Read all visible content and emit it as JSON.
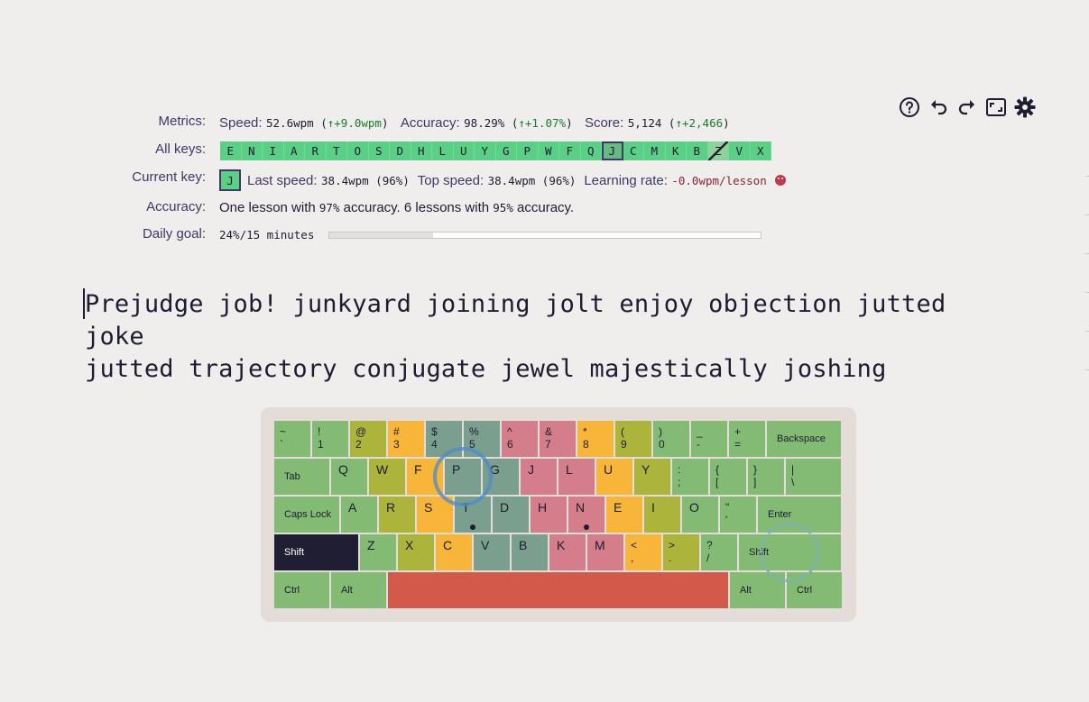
{
  "toolbar": {
    "help_icon": "help-circle-icon",
    "undo_icon": "undo-icon",
    "redo_icon": "redo-icon",
    "fullscreen_icon": "fullscreen-icon",
    "settings_icon": "gear-icon"
  },
  "metrics": {
    "label": "Metrics:",
    "speed_label": "Speed:",
    "speed_value": "52.6wpm",
    "speed_delta": "↑+9.0wpm",
    "accuracy_label": "Accuracy:",
    "accuracy_value": "98.29%",
    "accuracy_delta": "↑+1.07%",
    "score_label": "Score:",
    "score_value": "5,124",
    "score_delta": "↑+2,466"
  },
  "all_keys": {
    "label": "All keys:",
    "keys": [
      "E",
      "N",
      "I",
      "A",
      "R",
      "T",
      "O",
      "S",
      "D",
      "H",
      "L",
      "U",
      "Y",
      "G",
      "P",
      "W",
      "F",
      "Q",
      "J",
      "C",
      "M",
      "K",
      "B",
      "Z",
      "V",
      "X"
    ],
    "current": "J",
    "excluded": "Z"
  },
  "current_key": {
    "label": "Current key:",
    "key": "J",
    "last_speed_label": "Last speed:",
    "last_speed_value": "38.4wpm (96%)",
    "top_speed_label": "Top speed:",
    "top_speed_value": "38.4wpm (96%)",
    "learning_rate_label": "Learning rate:",
    "learning_rate_value": "-0.0wpm/lesson",
    "mood_icon": "sad-face-icon"
  },
  "accuracy_row": {
    "label": "Accuracy:",
    "text_a": "One lesson with ",
    "pct_a": "97%",
    "text_b": " accuracy. 6 lessons with ",
    "pct_b": "95%",
    "text_c": " accuracy."
  },
  "daily_goal": {
    "label": "Daily goal:",
    "value": "24%/15 minutes",
    "progress": 0.24
  },
  "lesson": {
    "line1": "Prejudge job! junkyard joining jolt enjoy objection jutted joke",
    "line2": "jutted trajectory conjugate jewel majestically joshing"
  },
  "keyboard": {
    "rows": [
      [
        {
          "t": "~",
          "b": "`",
          "c": "g",
          "w": 40
        },
        {
          "t": "!",
          "b": "1",
          "c": "g",
          "w": 40
        },
        {
          "t": "@",
          "b": "2",
          "c": "y",
          "w": 40
        },
        {
          "t": "#",
          "b": "3",
          "c": "o",
          "w": 40
        },
        {
          "t": "$",
          "b": "4",
          "c": "t",
          "w": 40
        },
        {
          "t": "%",
          "b": "5",
          "c": "t",
          "w": 40
        },
        {
          "t": "^",
          "b": "6",
          "c": "p",
          "w": 40
        },
        {
          "t": "&",
          "b": "7",
          "c": "p",
          "w": 40
        },
        {
          "t": "*",
          "b": "8",
          "c": "o",
          "w": 40
        },
        {
          "t": "(",
          "b": "9",
          "c": "y",
          "w": 40
        },
        {
          "t": ")",
          "b": "0",
          "c": "g",
          "w": 40
        },
        {
          "t": "_",
          "b": "-",
          "c": "g",
          "w": 40
        },
        {
          "t": "+",
          "b": "=",
          "c": "g",
          "w": 40
        },
        {
          "s": "Backspace",
          "c": "g",
          "w": 82
        }
      ],
      [
        {
          "s": "Tab",
          "c": "g",
          "w": 61
        },
        {
          "k": "Q",
          "c": "g",
          "w": 40
        },
        {
          "k": "W",
          "c": "y",
          "w": 40
        },
        {
          "k": "F",
          "c": "o",
          "w": 40
        },
        {
          "k": "P",
          "c": "t",
          "w": 40
        },
        {
          "k": "G",
          "c": "t",
          "w": 40
        },
        {
          "k": "J",
          "c": "p",
          "w": 40
        },
        {
          "k": "L",
          "c": "p",
          "w": 40
        },
        {
          "k": "U",
          "c": "o",
          "w": 40
        },
        {
          "k": "Y",
          "c": "y",
          "w": 40
        },
        {
          "t": ":",
          "b": ";",
          "c": "g",
          "w": 40
        },
        {
          "t": "{",
          "b": "[",
          "c": "g",
          "w": 40
        },
        {
          "t": "}",
          "b": "]",
          "c": "g",
          "w": 40
        },
        {
          "t": "|",
          "b": "\\",
          "c": "g",
          "w": 61
        }
      ],
      [
        {
          "s": "Caps Lock",
          "c": "g",
          "w": 72
        },
        {
          "k": "A",
          "c": "g",
          "w": 40
        },
        {
          "k": "R",
          "c": "y",
          "w": 40
        },
        {
          "k": "S",
          "c": "o",
          "w": 40
        },
        {
          "k": "T",
          "c": "t",
          "w": 40,
          "bump": true
        },
        {
          "k": "D",
          "c": "t",
          "w": 40
        },
        {
          "k": "H",
          "c": "p",
          "w": 40
        },
        {
          "k": "N",
          "c": "p",
          "w": 40,
          "bump": true
        },
        {
          "k": "E",
          "c": "o",
          "w": 40
        },
        {
          "k": "I",
          "c": "y",
          "w": 40
        },
        {
          "k": "O",
          "c": "g",
          "w": 40
        },
        {
          "t": "\"",
          "b": "'",
          "c": "g",
          "w": 40
        },
        {
          "s": "Enter",
          "c": "g",
          "w": 92
        }
      ],
      [
        {
          "s": "Shift",
          "c": "d",
          "w": 93
        },
        {
          "k": "Z",
          "c": "g",
          "w": 40
        },
        {
          "k": "X",
          "c": "y",
          "w": 40
        },
        {
          "k": "C",
          "c": "o",
          "w": 40
        },
        {
          "k": "V",
          "c": "t",
          "w": 40
        },
        {
          "k": "B",
          "c": "t",
          "w": 40
        },
        {
          "k": "K",
          "c": "p",
          "w": 40
        },
        {
          "k": "M",
          "c": "p",
          "w": 40
        },
        {
          "t": "<",
          "b": ",",
          "c": "o",
          "w": 40
        },
        {
          "t": ">",
          "b": ".",
          "c": "y",
          "w": 40
        },
        {
          "t": "?",
          "b": "/",
          "c": "g",
          "w": 40
        },
        {
          "s": "Shift",
          "c": "g",
          "w": 113
        }
      ],
      [
        {
          "s": "Ctrl",
          "c": "g",
          "w": 61
        },
        {
          "s": "Alt",
          "c": "g",
          "w": 61
        },
        {
          "s": "",
          "c": "r",
          "w": 377
        },
        {
          "s": "Alt",
          "c": "g",
          "w": 61
        },
        {
          "s": "Ctrl",
          "c": "g",
          "w": 61
        }
      ]
    ]
  }
}
